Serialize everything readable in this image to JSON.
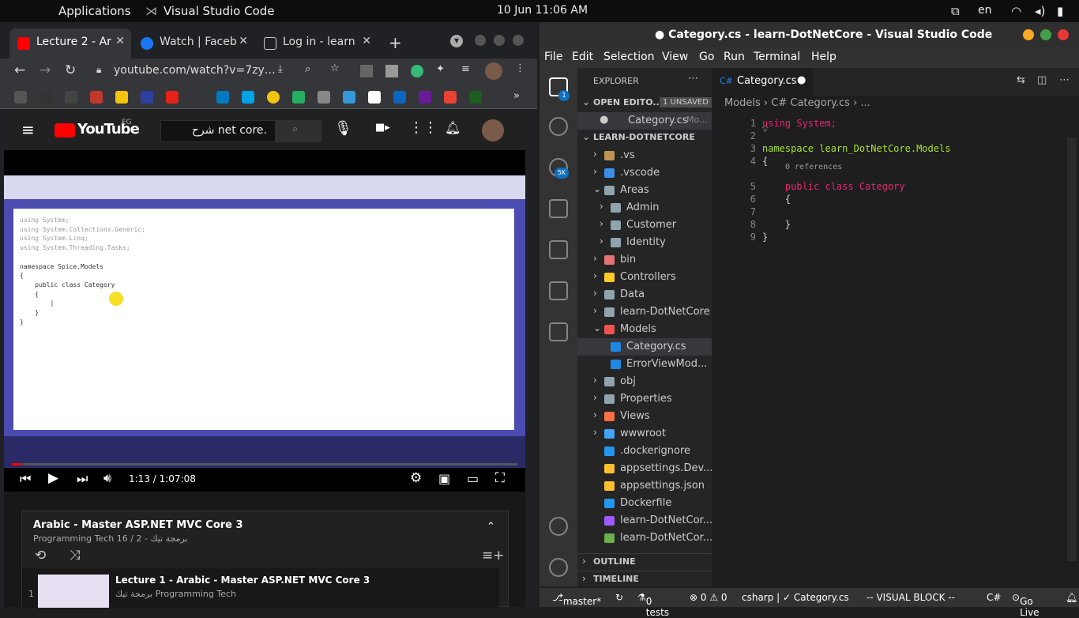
{
  "topbar": {
    "apps": "Applications",
    "app": "Visual Studio Code",
    "clock": "10 Jun  11:06 AM",
    "lang": "en"
  },
  "browser": {
    "tabs": [
      {
        "label": "Lecture 2 - Ar"
      },
      {
        "label": "Watch | Faceb"
      },
      {
        "label": "Log in - learn"
      }
    ],
    "url": "youtube.com/watch?v=7zy…",
    "youtube": {
      "logo": "YouTube",
      "region": "EG",
      "search_value": ".net core شرح",
      "time": "1:13 / 1:07:08"
    },
    "playlist": {
      "title": "Arabic - Master ASP.NET MVC Core 3",
      "subtitle": "Programming Tech برمجة تيك - 2 / 16",
      "item_num": "1",
      "item_title": "Lecture 1 - Arabic - Master ASP.NET MVC Core 3",
      "item_channel": "برمجة تيك Programming Tech"
    },
    "video_code": [
      "using System;",
      "using System.Collections.Generic;",
      "using System.Linq;",
      "using System.Threading.Tasks;",
      "",
      "namespace Spice.Models",
      "{",
      "    public class Category",
      "    {",
      "        |",
      "    }",
      "}",
      ""
    ]
  },
  "vscode": {
    "title": "● Category.cs - learn-DotNetCore - Visual Studio Code",
    "menu": [
      "File",
      "Edit",
      "Selection",
      "View",
      "Go",
      "Run",
      "Terminal",
      "Help"
    ],
    "explorer_label": "EXPLORER",
    "open_editors": "OPEN EDITO...",
    "unsaved": "1 UNSAVED",
    "open_file": "Category.cs",
    "open_file_dir": "Mo...",
    "project": "LEARN-DOTNETCORE",
    "tree": [
      {
        "name": ".vs",
        "chev": "›",
        "icon": "#c09553"
      },
      {
        "name": ".vscode",
        "chev": "›",
        "icon": "#3b8eea"
      },
      {
        "name": "Areas",
        "chev": "⌄",
        "icon": "#90a4ae"
      },
      {
        "name": "Admin",
        "chev": "›",
        "icon": "#90a4ae"
      },
      {
        "name": "Customer",
        "chev": "›",
        "icon": "#90a4ae"
      },
      {
        "name": "Identity",
        "chev": "›",
        "icon": "#90a4ae"
      },
      {
        "name": "bin",
        "chev": "›",
        "icon": "#e57373"
      },
      {
        "name": "Controllers",
        "chev": "›",
        "icon": "#ffca28"
      },
      {
        "name": "Data",
        "chev": "›",
        "icon": "#90a4ae"
      },
      {
        "name": "learn-DotNetCore",
        "chev": "›",
        "icon": "#90a4ae"
      },
      {
        "name": "Models",
        "chev": "⌄",
        "icon": "#ef5350"
      },
      {
        "name": "Category.cs",
        "chev": "",
        "icon": "#1e88e5"
      },
      {
        "name": "ErrorViewMod...",
        "chev": "",
        "icon": "#1e88e5"
      },
      {
        "name": "obj",
        "chev": "›",
        "icon": "#90a4ae"
      },
      {
        "name": "Properties",
        "chev": "›",
        "icon": "#90a4ae"
      },
      {
        "name": "Views",
        "chev": "›",
        "icon": "#ff7043"
      },
      {
        "name": "wwwroot",
        "chev": "›",
        "icon": "#42a5f5"
      },
      {
        "name": ".dockerignore",
        "chev": "",
        "icon": "#2496ed"
      },
      {
        "name": "appsettings.Dev...",
        "chev": "",
        "icon": "#fbc02d"
      },
      {
        "name": "appsettings.json",
        "chev": "",
        "icon": "#fbc02d"
      },
      {
        "name": "Dockerfile",
        "chev": "",
        "icon": "#2496ed"
      },
      {
        "name": "learn-DotNetCor...",
        "chev": "",
        "icon": "#a259ff"
      },
      {
        "name": "learn-DotNetCor...",
        "chev": "",
        "icon": "#6ab04c"
      }
    ],
    "outline": "OUTLINE",
    "timeline": "TIMELINE",
    "editor_tab": "Category.cs",
    "breadcrumb": "Models  ›  C# Category.cs  › ...",
    "code": [
      {
        "n": "1",
        "t": "using System;"
      },
      {
        "n": "2",
        "t": ""
      },
      {
        "n": "3",
        "t": "namespace learn_DotNetCore.Models"
      },
      {
        "n": "4",
        "t": "{"
      },
      {
        "n": "5",
        "t": "    public class Category"
      },
      {
        "n": "6",
        "t": "    {"
      },
      {
        "n": "7",
        "t": ""
      },
      {
        "n": "8",
        "t": "    }"
      },
      {
        "n": "9",
        "t": "}"
      }
    ],
    "references": "0 references",
    "status": {
      "branch": "master*",
      "tests": "0 tests",
      "errors": "⊗ 0 ⚠ 0",
      "lang_file": "csharp | ✓ Category.cs",
      "mode": "-- VISUAL BLOCK --",
      "lang": "C#",
      "live": "Go Live",
      "badge": "5K",
      "badge2": "1"
    }
  }
}
